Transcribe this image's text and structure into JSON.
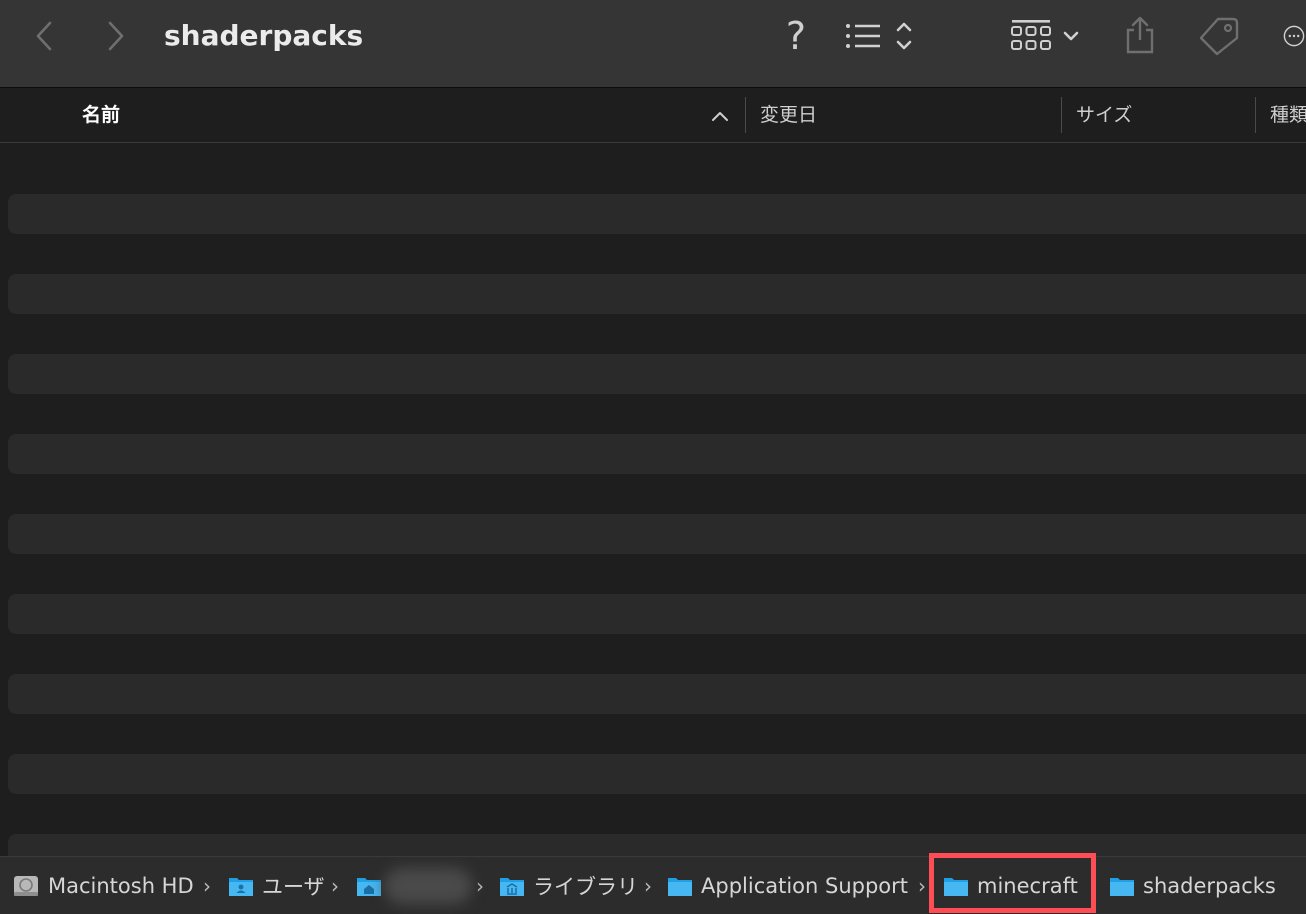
{
  "window": {
    "title": "shaderpacks"
  },
  "toolbar": {
    "back_icon": "chevron-left-icon",
    "forward_icon": "chevron-right-icon",
    "help_label": "?",
    "view_options_icon": "list-view-icon",
    "group_icon": "grid-group-icon",
    "share_icon": "share-icon",
    "tag_icon": "tag-icon",
    "more_icon": "ellipsis-circle-icon"
  },
  "columns": {
    "name": "名前",
    "date": "変更日",
    "size": "サイズ",
    "kind": "種類",
    "sort_indicator": "^"
  },
  "pathbar": {
    "items": [
      {
        "label": "Macintosh HD",
        "icon": "hard-drive-icon"
      },
      {
        "label": "ユーザ",
        "icon": "users-folder-icon"
      },
      {
        "label": "",
        "icon": "home-folder-icon"
      },
      {
        "label": "ライブラリ",
        "icon": "library-folder-icon"
      },
      {
        "label": "Application Support",
        "icon": "folder-icon"
      },
      {
        "label": "minecraft",
        "icon": "folder-icon"
      },
      {
        "label": "shaderpacks",
        "icon": "folder-icon"
      }
    ],
    "separator": "›"
  },
  "colors": {
    "toolbar_bg": "#353535",
    "content_bg": "#1e1e1e",
    "stripe_bg": "#2a2a2b",
    "folder_blue": "#1fa0e6",
    "highlight": "#ff4d55"
  }
}
